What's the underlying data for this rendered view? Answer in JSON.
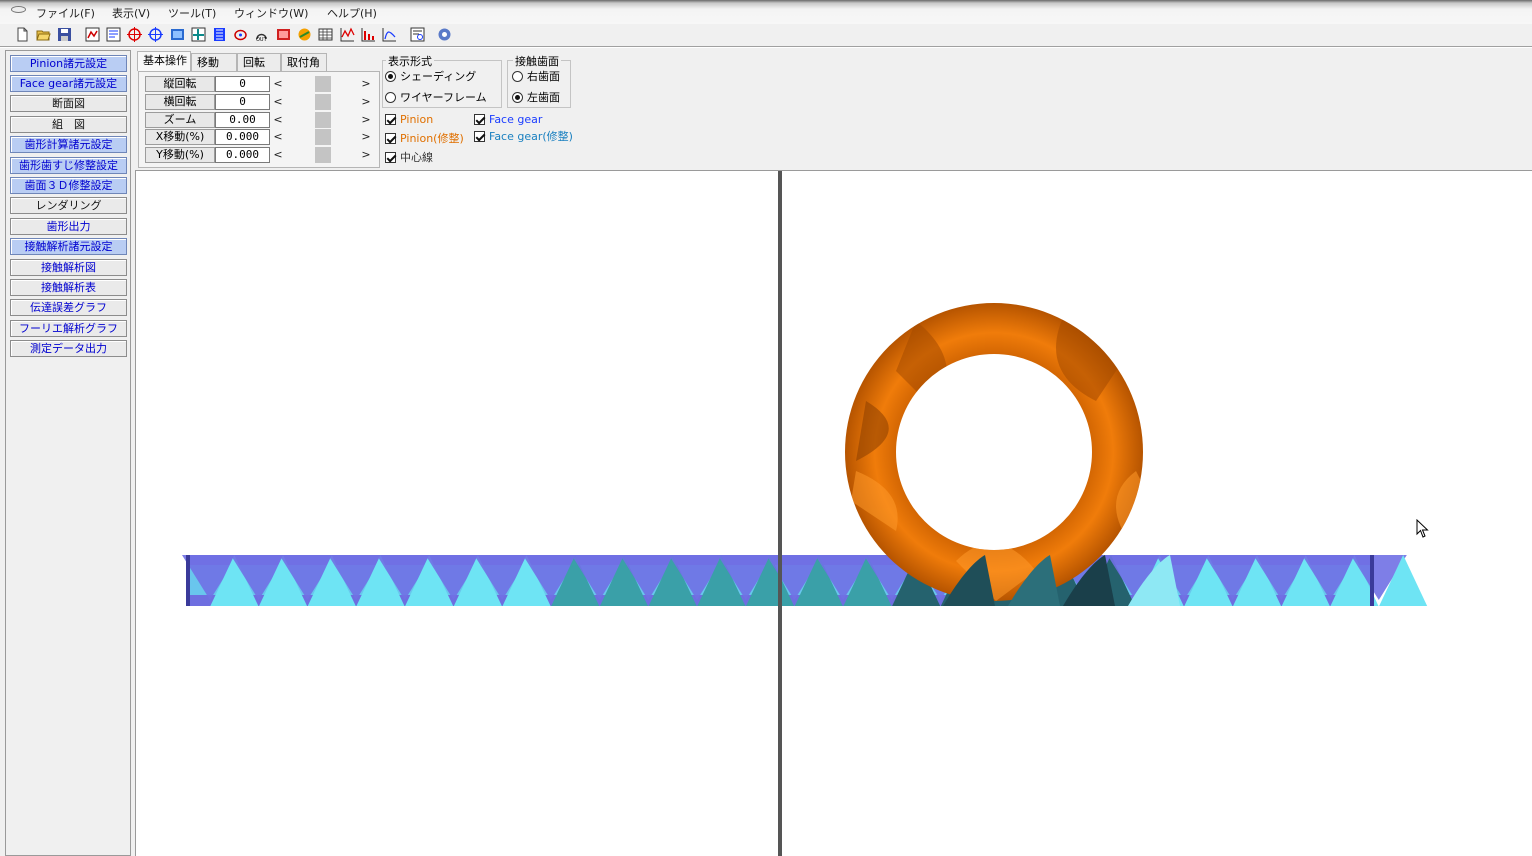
{
  "menu": {
    "file": "ファイル(F)",
    "view": "表示(V)",
    "tools": "ツール(T)",
    "window": "ウィンドウ(W)",
    "help": "ヘルプ(H)"
  },
  "sidebar": {
    "items": [
      {
        "label": "Pinion諸元設定"
      },
      {
        "label": "Face gear諸元設定"
      },
      {
        "label": "断面図"
      },
      {
        "label": "組　図"
      },
      {
        "label": "歯形計算諸元設定"
      },
      {
        "label": "歯形歯すじ修整設定"
      },
      {
        "label": "歯面３Ｄ修整設定"
      },
      {
        "label": "レンダリング"
      },
      {
        "label": "歯形出力"
      },
      {
        "label": "接触解析諸元設定"
      },
      {
        "label": "接触解析図"
      },
      {
        "label": "接触解析表"
      },
      {
        "label": "伝達誤差グラフ"
      },
      {
        "label": "フーリエ解析グラフ"
      },
      {
        "label": "測定データ出力"
      }
    ]
  },
  "tabs": [
    "基本操作",
    "移動",
    "回転",
    "取付角"
  ],
  "controls": {
    "rows": [
      {
        "label": "縦回転",
        "value": "0",
        "slider_fraction": 0.5
      },
      {
        "label": "横回転",
        "value": "0",
        "slider_fraction": 0.5
      },
      {
        "label": "ズーム",
        "value": "0.00",
        "slider_fraction": 0.5
      },
      {
        "label": "X移動(%)",
        "value": "0.000",
        "slider_fraction": 0.5
      },
      {
        "label": "Y移動(%)",
        "value": "0.000",
        "slider_fraction": 0.5
      }
    ],
    "arrow_left": "<",
    "arrow_right": ">"
  },
  "display_mode": {
    "title": "表示形式",
    "shading": "シェーディング",
    "wireframe": "ワイヤーフレーム",
    "selected": "shading"
  },
  "contact_face": {
    "title": "接触歯面",
    "right": "右歯面",
    "left": "左歯面",
    "selected": "left"
  },
  "visibility": {
    "pinion": "Pinion",
    "pinion_mod": "Pinion(修整)",
    "face_gear": "Face gear",
    "face_gear_mod": "Face gear(修整)",
    "center_line": "中心線"
  },
  "colors": {
    "pinion": "#f07c0a",
    "face_gear": "#5fd8ea",
    "face_gear_back": "#6e6ee0",
    "selected_button": "#b9cdf3"
  }
}
